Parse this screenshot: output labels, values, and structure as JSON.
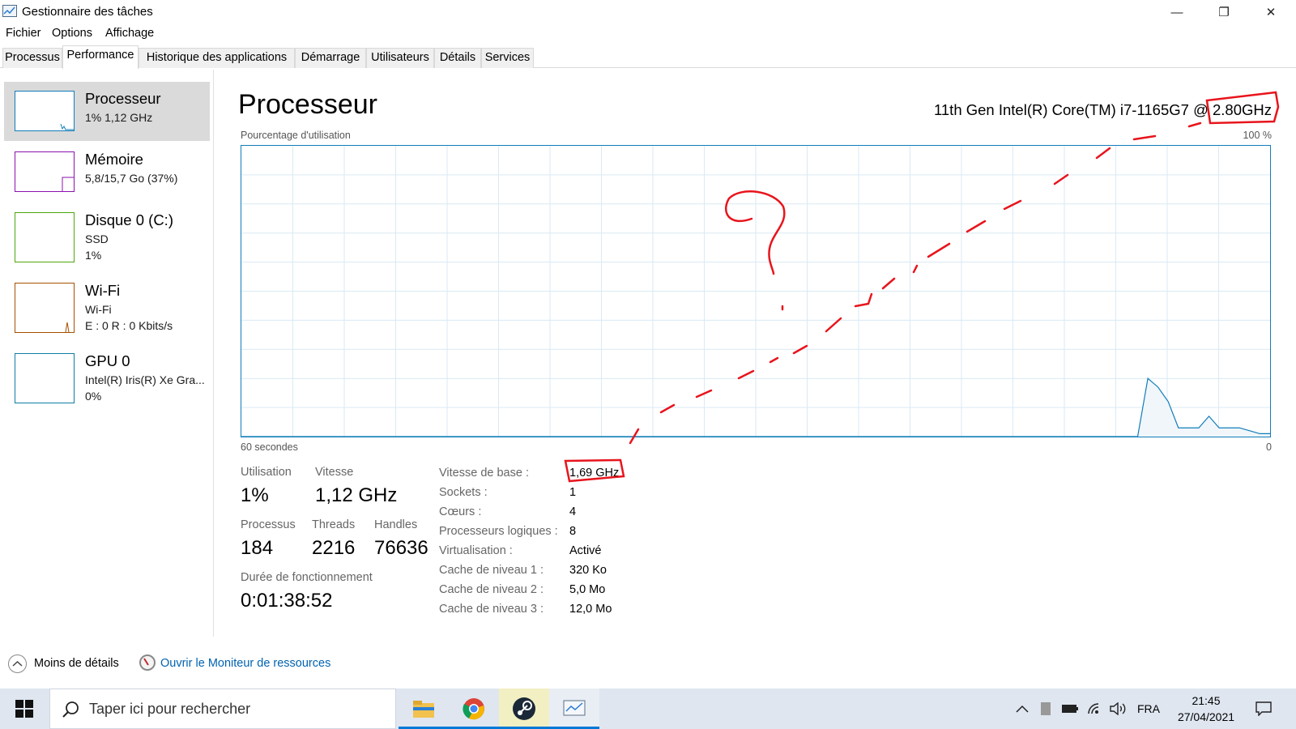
{
  "window": {
    "title": "Gestionnaire des tâches",
    "controls": {
      "minimize": "—",
      "restore": "❐",
      "close": "✕"
    }
  },
  "menu": [
    "Fichier",
    "Options",
    "Affichage"
  ],
  "tabs": [
    "Processus",
    "Performance",
    "Historique des applications",
    "Démarrage",
    "Utilisateurs",
    "Détails",
    "Services"
  ],
  "active_tab": "Performance",
  "sidebar": {
    "items": [
      {
        "name": "Processeur",
        "line1": "1%  1,12 GHz",
        "line2": "",
        "color": "#117dbb",
        "selected": true
      },
      {
        "name": "Mémoire",
        "line1": "5,8/15,7 Go (37%)",
        "line2": "",
        "color": "#8b12ae",
        "selected": false
      },
      {
        "name": "Disque 0 (C:)",
        "line1": "SSD",
        "line2": "1%",
        "color": "#4da60c",
        "selected": false
      },
      {
        "name": "Wi-Fi",
        "line1": "Wi-Fi",
        "line2": "E : 0 R : 0 Kbits/s",
        "color": "#a74f01",
        "selected": false
      },
      {
        "name": "GPU 0",
        "line1": "Intel(R) Iris(R) Xe Gra...",
        "line2": "0%",
        "color": "#0e7ea6",
        "selected": false
      }
    ]
  },
  "main": {
    "title": "Processeur",
    "cpu_model": "11th Gen Intel(R) Core(TM) i7-1165G7 @ 2.80GHz",
    "graph_label": "Pourcentage d'utilisation",
    "graph_max": "100 %",
    "graph_time": "60 secondes",
    "graph_min": "0",
    "stats": {
      "utilisation_label": "Utilisation",
      "utilisation": "1%",
      "vitesse_label": "Vitesse",
      "vitesse": "1,12 GHz",
      "processus_label": "Processus",
      "processus": "184",
      "threads_label": "Threads",
      "threads": "2216",
      "handles_label": "Handles",
      "handles": "76636",
      "uptime_label": "Durée de fonctionnement",
      "uptime": "0:01:38:52"
    },
    "info": [
      {
        "label": "Vitesse de base :",
        "value": "1,69 GHz"
      },
      {
        "label": "Sockets :",
        "value": "1"
      },
      {
        "label": "Cœurs :",
        "value": "4"
      },
      {
        "label": "Processeurs logiques :",
        "value": "8"
      },
      {
        "label": "Virtualisation :",
        "value": "Activé"
      },
      {
        "label": "Cache de niveau 1 :",
        "value": "320 Ko"
      },
      {
        "label": "Cache de niveau 2 :",
        "value": "5,0 Mo"
      },
      {
        "label": "Cache de niveau 3 :",
        "value": "12,0 Mo"
      }
    ],
    "usage_history_percent": [
      0,
      0,
      0,
      0,
      0,
      0,
      0,
      0,
      0,
      0,
      0,
      0,
      0,
      0,
      0,
      0,
      0,
      0,
      0,
      0,
      0,
      0,
      0,
      0,
      0,
      0,
      0,
      0,
      0,
      0,
      0,
      0,
      0,
      0,
      0,
      0,
      0,
      0,
      0,
      0,
      0,
      0,
      0,
      0,
      0,
      0,
      0,
      0,
      0,
      0,
      0,
      0,
      0,
      0,
      0,
      0,
      0,
      0,
      0,
      0,
      0,
      0,
      0,
      0,
      0,
      0,
      0,
      0,
      0,
      0,
      0,
      0,
      0,
      0,
      0,
      0,
      0,
      0,
      0,
      0,
      0,
      0,
      0,
      0,
      0,
      0,
      0,
      0,
      0,
      20,
      17,
      12,
      3,
      3,
      3,
      7,
      3,
      3,
      3,
      2,
      1,
      1
    ]
  },
  "footer": {
    "less_details": "Moins de détails",
    "open_monitor": "Ouvrir le Moniteur de ressources"
  },
  "taskbar": {
    "search_placeholder": "Taper ici pour rechercher",
    "apps": [
      "file-explorer-icon",
      "chrome-icon",
      "steam-icon",
      "task-manager-icon"
    ],
    "language": "FRA",
    "time": "21:45",
    "date": "27/04/2021"
  },
  "colors": {
    "cpu_line": "#117dbb",
    "cpu_fill": "#f1f6fa",
    "grid": "#d9eaf4",
    "annotation": "#e8141c",
    "link": "#0063b1"
  }
}
